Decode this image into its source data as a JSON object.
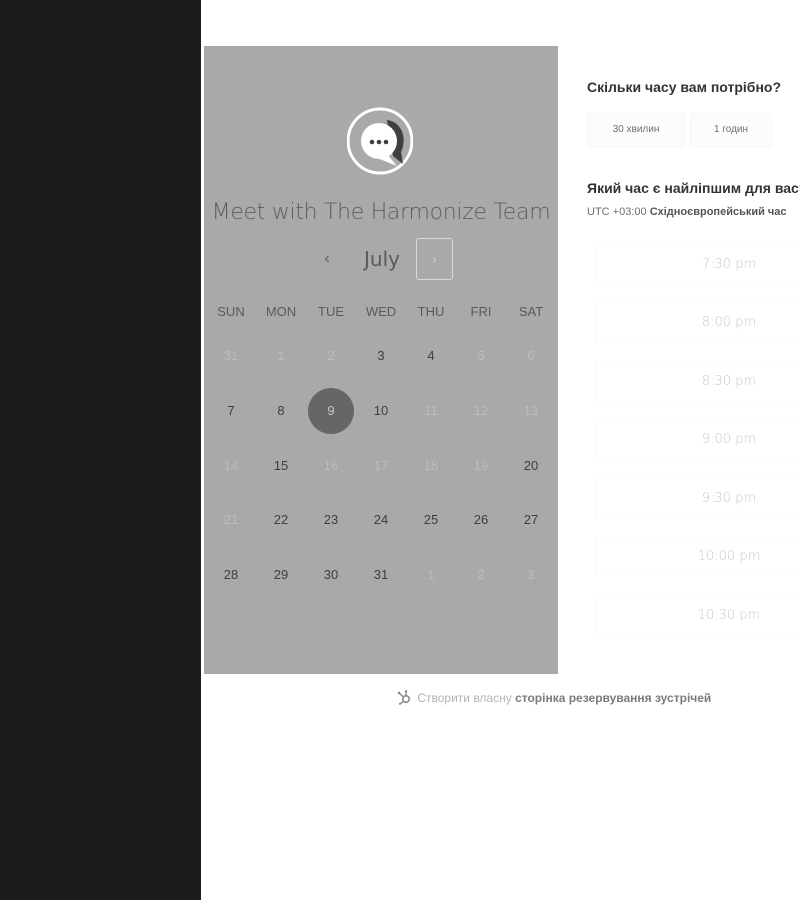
{
  "calendar": {
    "title": "Meet with The Harmonize Team",
    "month": "July",
    "prev_icon": "‹",
    "next_icon": "›",
    "weekdays": [
      "SUN",
      "MON",
      "TUE",
      "WED",
      "THU",
      "FRI",
      "SAT"
    ],
    "weeks": [
      [
        {
          "label": "31",
          "state": "unavailable"
        },
        {
          "label": "1",
          "state": "unavailable"
        },
        {
          "label": "2",
          "state": "unavailable"
        },
        {
          "label": "3",
          "state": "available"
        },
        {
          "label": "4",
          "state": "available"
        },
        {
          "label": "5",
          "state": "unavailable"
        },
        {
          "label": "6",
          "state": "unavailable"
        }
      ],
      [
        {
          "label": "7",
          "state": "available"
        },
        {
          "label": "8",
          "state": "available"
        },
        {
          "label": "9",
          "state": "selected"
        },
        {
          "label": "10",
          "state": "available"
        },
        {
          "label": "11",
          "state": "unavailable"
        },
        {
          "label": "12",
          "state": "unavailable"
        },
        {
          "label": "13",
          "state": "unavailable"
        }
      ],
      [
        {
          "label": "14",
          "state": "unavailable"
        },
        {
          "label": "15",
          "state": "available"
        },
        {
          "label": "16",
          "state": "unavailable"
        },
        {
          "label": "17",
          "state": "unavailable"
        },
        {
          "label": "18",
          "state": "unavailable"
        },
        {
          "label": "19",
          "state": "unavailable"
        },
        {
          "label": "20",
          "state": "available"
        }
      ],
      [
        {
          "label": "21",
          "state": "unavailable"
        },
        {
          "label": "22",
          "state": "available"
        },
        {
          "label": "23",
          "state": "available"
        },
        {
          "label": "24",
          "state": "available"
        },
        {
          "label": "25",
          "state": "available"
        },
        {
          "label": "26",
          "state": "available"
        },
        {
          "label": "27",
          "state": "available"
        }
      ],
      [
        {
          "label": "28",
          "state": "available"
        },
        {
          "label": "29",
          "state": "available"
        },
        {
          "label": "30",
          "state": "available"
        },
        {
          "label": "31",
          "state": "available"
        },
        {
          "label": "1",
          "state": "unavailable"
        },
        {
          "label": "2",
          "state": "unavailable"
        },
        {
          "label": "3",
          "state": "unavailable"
        }
      ]
    ]
  },
  "duration": {
    "question": "Скільки часу вам потрібно?",
    "options": [
      "30 хвилин",
      "1 годин"
    ]
  },
  "time_selection": {
    "question": "Який час є найліпшим для вас?",
    "timezone_offset": "UTC +03:00",
    "timezone_name": "Східноєвропейський час",
    "slots": [
      "7:30 pm",
      "8:00 pm",
      "8:30 pm",
      "9:00 pm",
      "9:30 pm",
      "10:00 pm",
      "10:30 pm"
    ]
  },
  "footer": {
    "prefix": "Створити власну",
    "link": "сторінка резервування зустрічей"
  },
  "colors": {
    "left_bar": "#1c1c1c",
    "calendar_panel": "#a9a9a9",
    "selected_day": "#666666"
  }
}
